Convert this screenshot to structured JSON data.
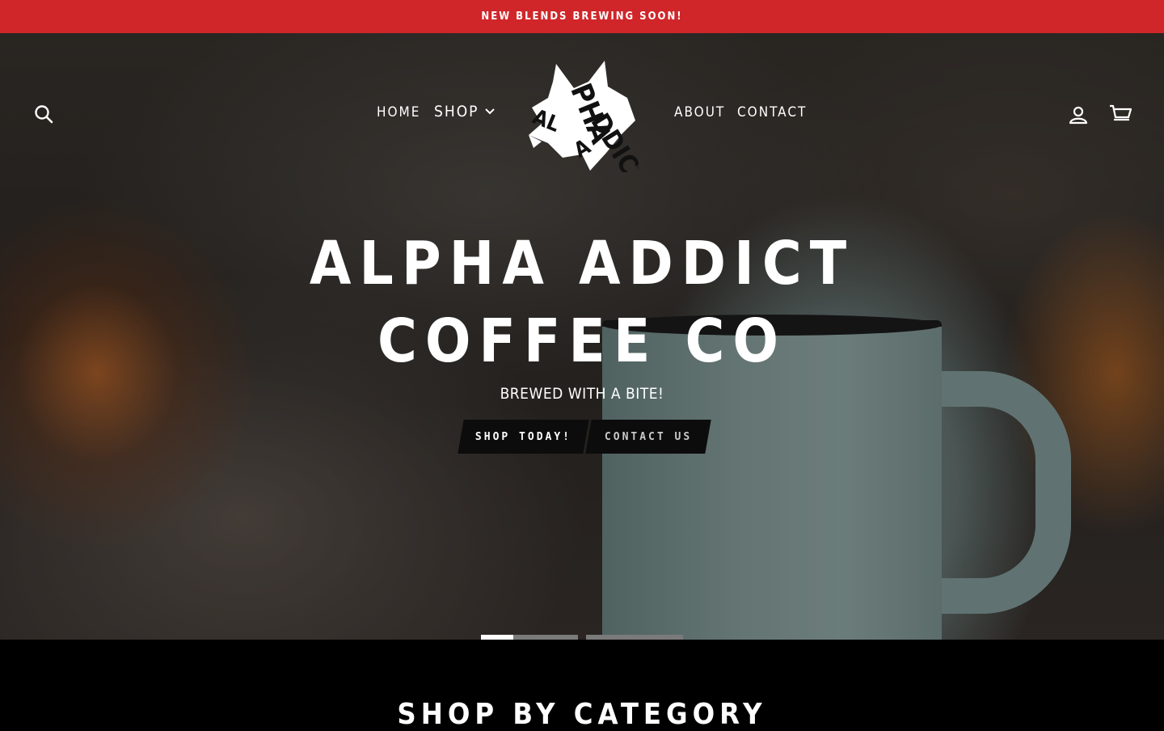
{
  "announcement": {
    "text": "NEW BLENDS BREWING SOON!"
  },
  "colors": {
    "announcement_bg": "#d0262a",
    "page_bg": "#000000",
    "text": "#ffffff"
  },
  "header": {
    "search_icon": "search-icon",
    "account_icon": "user-icon",
    "cart_icon": "cart-icon",
    "logo_text": "ALPHA ADDICT",
    "nav": {
      "home": "HOME",
      "shop": "SHOP",
      "about": "ABOUT",
      "contact": "CONTACT"
    }
  },
  "hero": {
    "title_line1": "ALPHA ADDICT",
    "title_line2": "COFFEE CO",
    "subtitle": "BREWED WITH A BITE!",
    "primary_button": "SHOP TODAY!",
    "secondary_button": "CONTACT US",
    "slides": [
      {
        "progress": 0.33
      },
      {
        "progress": 0
      }
    ]
  },
  "category": {
    "title": "SHOP BY CATEGORY"
  }
}
